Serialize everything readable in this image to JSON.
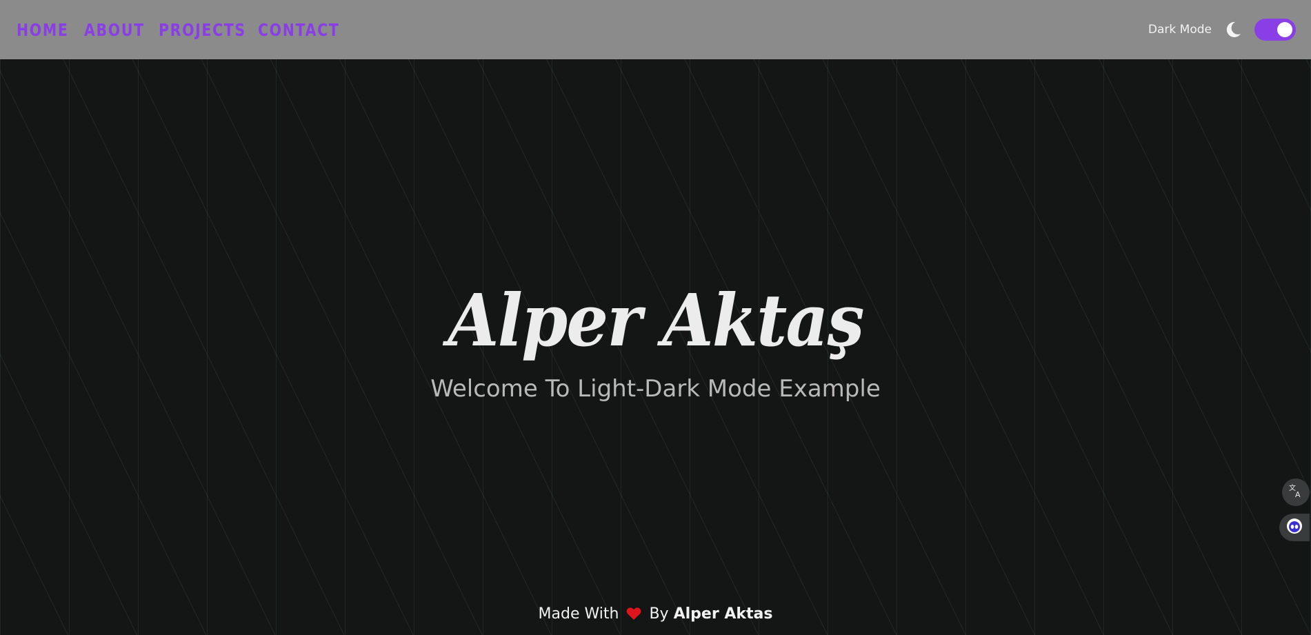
{
  "nav": {
    "links": [
      "HOME",
      "ABOUT",
      "PROJECTS",
      "CONTACT"
    ],
    "mode_label": "Dark Mode",
    "toggle_on": true,
    "accent_color": "#8a3fe6"
  },
  "hero": {
    "title": "Alper Aktaş",
    "subtitle": "Welcome To Light-Dark Mode Example"
  },
  "footer": {
    "made_with": "Made With",
    "by": "By",
    "author": "Alper Aktas"
  },
  "floating": {
    "translate_icon": "translate-icon",
    "assistant_icon": "assistant-icon"
  },
  "colors": {
    "background": "#141515",
    "navbar": "#8b8b8b",
    "heart": "#e0141c"
  }
}
